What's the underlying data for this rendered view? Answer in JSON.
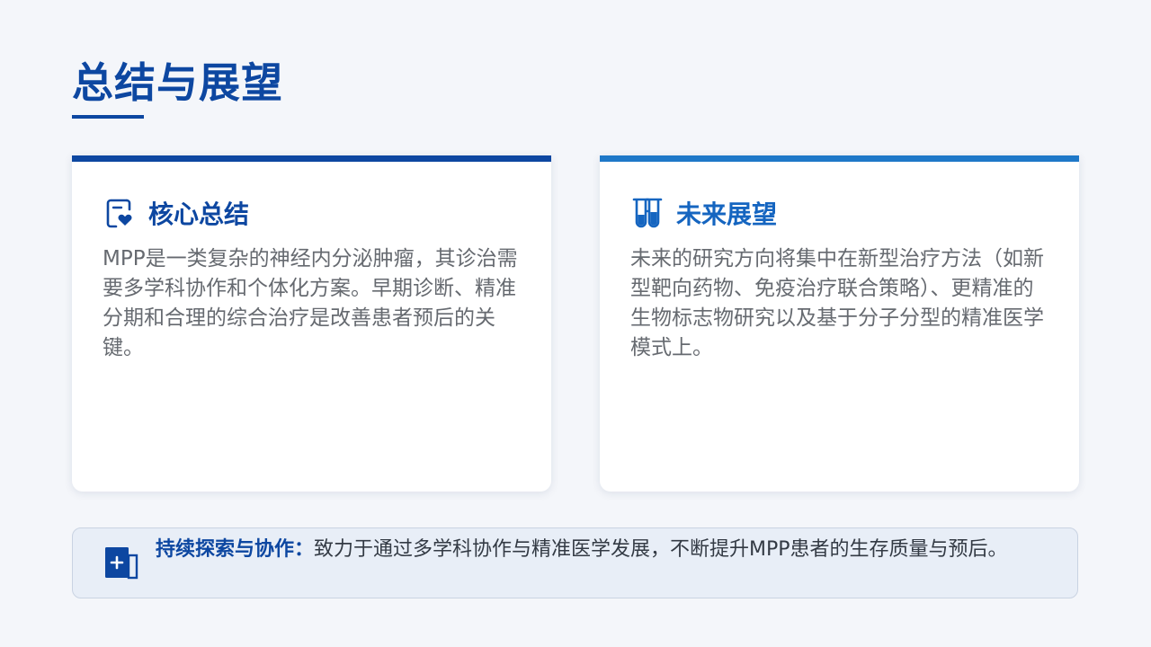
{
  "page": {
    "title": "总结与展望"
  },
  "cards": {
    "summary": {
      "heading": "核心总结",
      "icon": "document-heart-icon",
      "body": "MPP是一类复杂的神经内分泌肿瘤，其诊治需要多学科协作和个体化方案。早期诊断、精准分期和合理的综合治疗是改善患者预后的关键。"
    },
    "outlook": {
      "heading": "未来展望",
      "icon": "test-tubes-icon",
      "body": "未来的研究方向将集中在新型治疗方法（如新型靶向药物、免疫治疗联合策略）、更精准的生物标志物研究以及基于分子分型的精准医学模式上。"
    }
  },
  "banner": {
    "icon": "medical-plus-icon",
    "strong": "持续探索与协作：",
    "text": "致力于通过多学科协作与精准医学发展，不断提升MPP患者的生存质量与预后。"
  },
  "colors": {
    "primary": "#0d47a1",
    "accent": "#1e78c8",
    "background": "#f4f6fa",
    "banner_bg": "#e8eef7"
  }
}
